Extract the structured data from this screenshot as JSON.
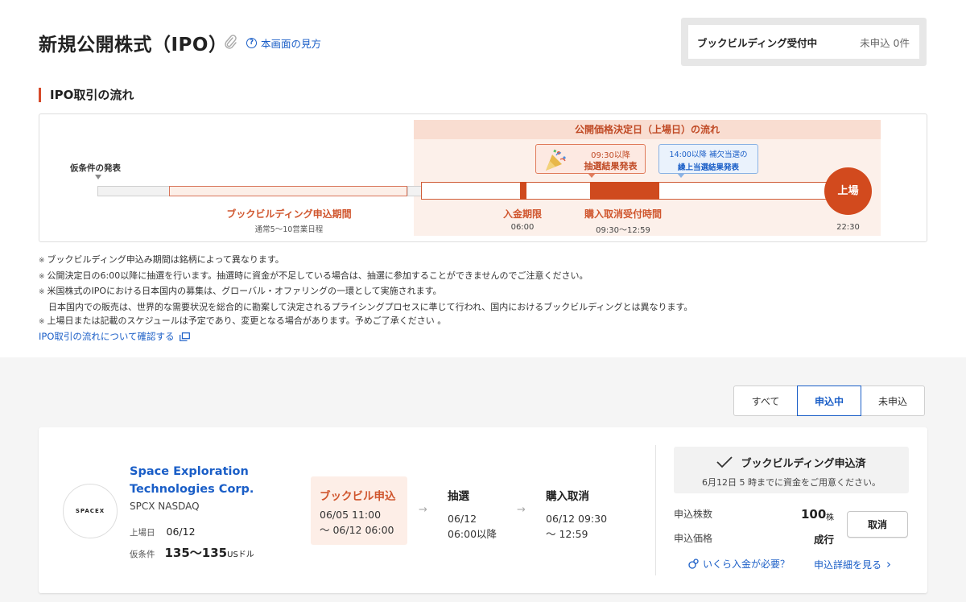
{
  "header": {
    "title": "新規公開株式（IPO）",
    "help_link": "本画面の見方",
    "status_label": "ブックビルディング受付中",
    "status_count": "未申込 0件"
  },
  "flow": {
    "section_title": "IPO取引の流れ",
    "pink_header": "公開価格決定日（上場日）の流れ",
    "tentative_label": "仮条件の発表",
    "lottery_time": "09:30以降",
    "lottery_text": "抽選結果発表",
    "backup_time": "14:00以降 補欠当選の",
    "backup_text": "繰上当選結果発表",
    "listing_label": "上場",
    "bb_period_label": "ブックビルディング申込期間",
    "bb_period_sub": "通常5〜10営業日程",
    "deposit_label": "入金期限",
    "deposit_time": "06:00",
    "cancel_label": "購入取消受付時間",
    "cancel_time": "09:30〜12:59",
    "listing_time": "22:30"
  },
  "notes": [
    "ブックビルディング申込み期間は銘柄によって異なります。",
    "公開決定日の6:00以降に抽選を行います。抽選時に資金が不足している場合は、抽選に参加することができませんのでご注意ください。",
    "米国株式のIPOにおける日本国内の募集は、グローバル・オファリングの一環として実施されます。",
    "日本国内での販売は、世界的な需要状況を総合的に勘案して決定されるプライシングプロセスに準じて行われ、国内におけるブックビルディングとは異なります。",
    "上場日または記載のスケジュールは予定であり、変更となる場合があります。予めご了承ください 。"
  ],
  "note_mark": "※",
  "flow_link": "IPO取引の流れについて確認する",
  "filters": [
    "すべて",
    "申込中",
    "未申込"
  ],
  "card": {
    "logo_text": "SPACEX",
    "company_name": "Space Exploration Technologies Corp.",
    "ticker": "SPCX NASDAQ",
    "listing_date_label": "上場日",
    "listing_date": "06/12",
    "price_label": "仮条件",
    "price_range": "135〜135",
    "price_unit": "USドル",
    "steps": {
      "bb": {
        "title": "ブックビル申込",
        "line1": "06/05 11:00",
        "line2": "〜 06/12 06:00"
      },
      "lottery": {
        "title": "抽選",
        "line1": "06/12",
        "line2": "06:00以降"
      },
      "cancel": {
        "title": "購入取消",
        "line1": "06/12 09:30",
        "line2": "〜 12:59"
      }
    },
    "arrow": "→",
    "done_text": "ブックビルディング申込済",
    "done_sub": "6月12日 5 時までに資金をご用意ください。",
    "qty_label": "申込株数",
    "qty_value": "100",
    "qty_unit": "株",
    "price_type_label": "申込価格",
    "price_type_value": "成行",
    "cancel_button": "取消",
    "need_link": "いくら入金が必要？",
    "detail_link": "申込詳細を見る",
    "chevron": "›"
  },
  "colors": {
    "accent": "#d0562e",
    "link": "#1a5ec7",
    "listing": "#d24a1e"
  }
}
